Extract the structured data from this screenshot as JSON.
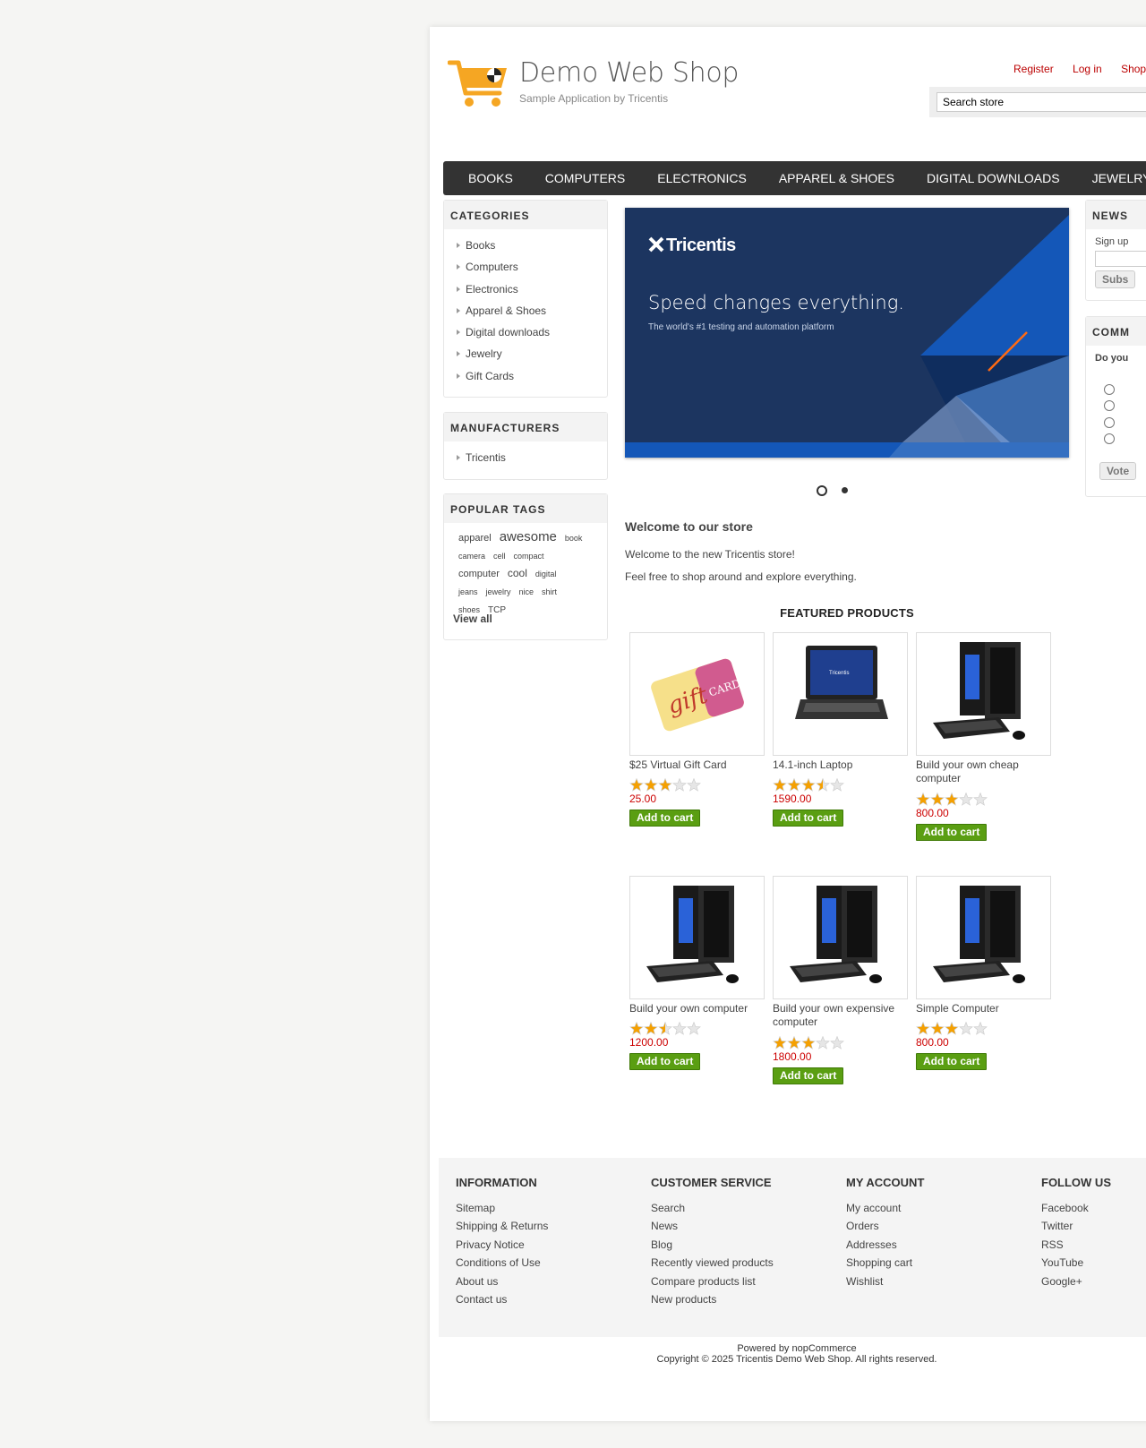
{
  "header": {
    "title": "Demo Web Shop",
    "subtitle": "Sample Application by Tricentis",
    "links": [
      "Register",
      "Log in",
      "Shop"
    ],
    "search_placeholder": "Search store"
  },
  "topmenu": [
    "BOOKS",
    "COMPUTERS",
    "ELECTRONICS",
    "APPAREL & SHOES",
    "DIGITAL DOWNLOADS",
    "JEWELRY"
  ],
  "categories": {
    "title": "CATEGORIES",
    "items": [
      "Books",
      "Computers",
      "Electronics",
      "Apparel & Shoes",
      "Digital downloads",
      "Jewelry",
      "Gift Cards"
    ]
  },
  "manufacturers": {
    "title": "MANUFACTURERS",
    "items": [
      "Tricentis"
    ]
  },
  "popular_tags": {
    "title": "POPULAR TAGS",
    "tags": [
      "apparel",
      "awesome",
      "book",
      "camera",
      "cell",
      "compact",
      "computer",
      "cool",
      "digital",
      "jeans",
      "jewelry",
      "nice",
      "shirt",
      "shoes",
      "TCP"
    ],
    "view_all": "View all"
  },
  "newsletter": {
    "title": "NEWS",
    "signup": "Sign up",
    "button": "Subs"
  },
  "poll": {
    "title": "COMM",
    "question": "Do you",
    "button": "Vote"
  },
  "banner": {
    "brand": "Tricentis",
    "headline": "Speed changes everything.",
    "tagline": "The world's #1 testing and automation platform"
  },
  "welcome": {
    "heading": "Welcome to our store",
    "lines": [
      "Welcome to the new Tricentis store!",
      "Feel free to shop around and explore everything."
    ]
  },
  "featured": {
    "heading": "FEATURED PRODUCTS",
    "add_to_cart": "Add to cart",
    "products": [
      {
        "title": "$25 Virtual Gift Card",
        "price": "25.00",
        "rating": 3,
        "image": "gift-card"
      },
      {
        "title": "14.1-inch Laptop",
        "price": "1590.00",
        "rating": 3.5,
        "image": "laptop"
      },
      {
        "title": "Build your own cheap computer",
        "price": "800.00",
        "rating": 3,
        "image": "desktop"
      },
      {
        "title": "Build your own computer",
        "price": "1200.00",
        "rating": 2.5,
        "image": "desktop"
      },
      {
        "title": "Build your own expensive computer",
        "price": "1800.00",
        "rating": 3,
        "image": "desktop"
      },
      {
        "title": "Simple Computer",
        "price": "800.00",
        "rating": 3,
        "image": "desktop"
      }
    ]
  },
  "footer": {
    "columns": [
      {
        "title": "INFORMATION",
        "links": [
          "Sitemap",
          "Shipping & Returns",
          "Privacy Notice",
          "Conditions of Use",
          "About us",
          "Contact us"
        ]
      },
      {
        "title": "CUSTOMER SERVICE",
        "links": [
          "Search",
          "News",
          "Blog",
          "Recently viewed products",
          "Compare products list",
          "New products"
        ]
      },
      {
        "title": "MY ACCOUNT",
        "links": [
          "My account",
          "Orders",
          "Addresses",
          "Shopping cart",
          "Wishlist"
        ]
      },
      {
        "title": "FOLLOW US",
        "links": [
          "Facebook",
          "Twitter",
          "RSS",
          "YouTube",
          "Google+"
        ]
      }
    ],
    "powered_by": "Powered by nopCommerce",
    "copyright": "Copyright © 2025 Tricentis Demo Web Shop. All rights reserved."
  },
  "colors": {
    "accent_red": "#cc0000",
    "menu_bg": "#333333",
    "button_green": "#5a9e12",
    "banner_navy": "#1c3560",
    "logo_orange": "#f5a623"
  }
}
